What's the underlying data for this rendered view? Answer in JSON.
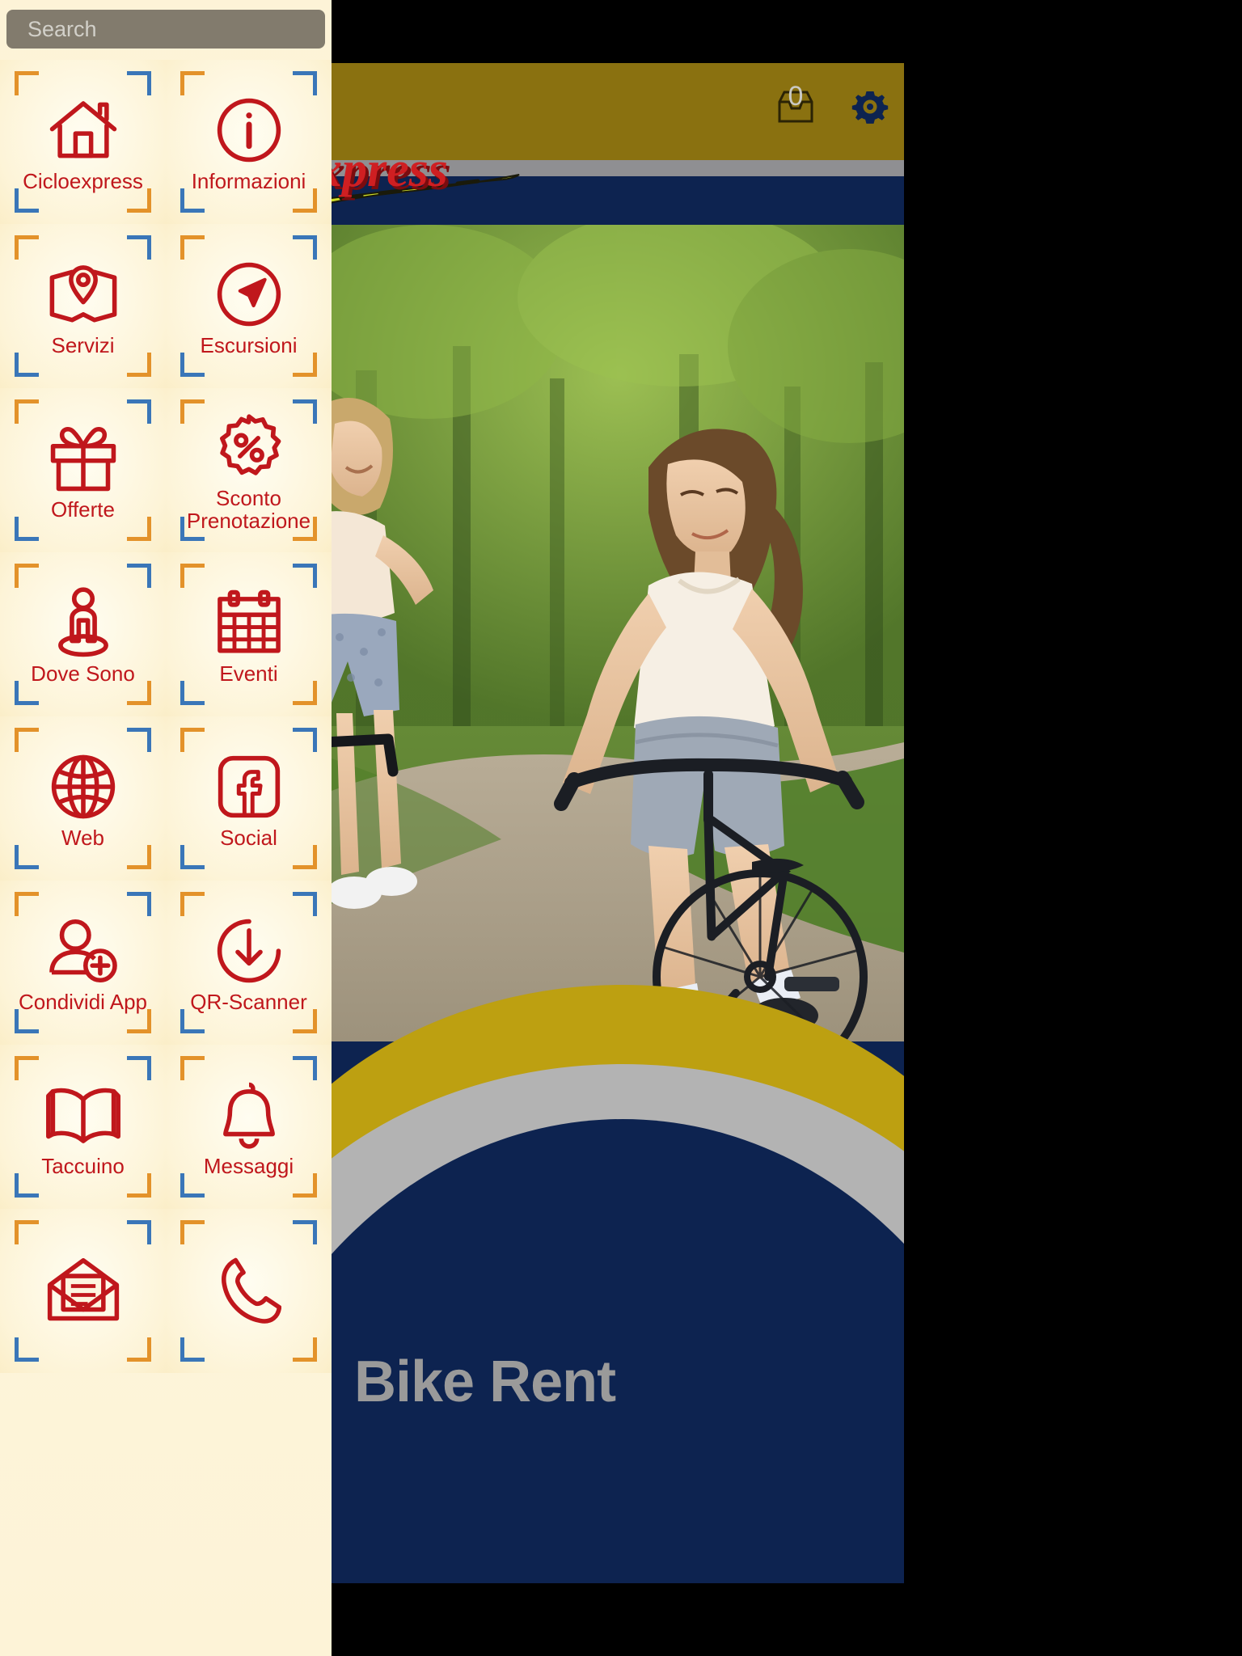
{
  "app": {
    "title": "Bike Rent",
    "brand_name": "Cicloexpress",
    "logo_text": "express"
  },
  "colors": {
    "accent_red": "#c0171c",
    "gold": "#bda011",
    "header_gold": "#8a7110",
    "navy": "#0d2350",
    "gray_band": "#b3b3b3",
    "sidebar_bg": "#fdf3d7",
    "bracket_orange": "#e3922a",
    "bracket_blue": "#3a76b8",
    "search_bg": "#827b6d",
    "title_gray": "#9a9a9a"
  },
  "search": {
    "placeholder": "Search",
    "value": "",
    "icon": "search-icon"
  },
  "header": {
    "inbox": {
      "icon": "inbox-icon",
      "badge": "0"
    },
    "settings": {
      "icon": "gear-icon"
    }
  },
  "menu": {
    "items": [
      {
        "label": "Cicloexpress",
        "icon": "home-icon"
      },
      {
        "label": "Informazioni",
        "icon": "info-circle-icon"
      },
      {
        "label": "Servizi",
        "icon": "map-pin-icon"
      },
      {
        "label": "Escursioni",
        "icon": "compass-icon"
      },
      {
        "label": "Offerte",
        "icon": "gift-icon"
      },
      {
        "label": "Sconto\nPrenotazione",
        "icon": "percent-badge-icon"
      },
      {
        "label": "Dove Sono",
        "icon": "person-location-icon"
      },
      {
        "label": "Eventi",
        "icon": "calendar-icon"
      },
      {
        "label": "Web",
        "icon": "globe-icon"
      },
      {
        "label": "Social",
        "icon": "facebook-icon"
      },
      {
        "label": "Condividi App",
        "icon": "add-user-icon"
      },
      {
        "label": "QR-Scanner",
        "icon": "download-circle-icon"
      },
      {
        "label": "Taccuino",
        "icon": "book-icon"
      },
      {
        "label": "Messaggi",
        "icon": "bell-icon"
      },
      {
        "label": "",
        "icon": "mail-icon"
      },
      {
        "label": "",
        "icon": "phone-icon"
      }
    ]
  }
}
